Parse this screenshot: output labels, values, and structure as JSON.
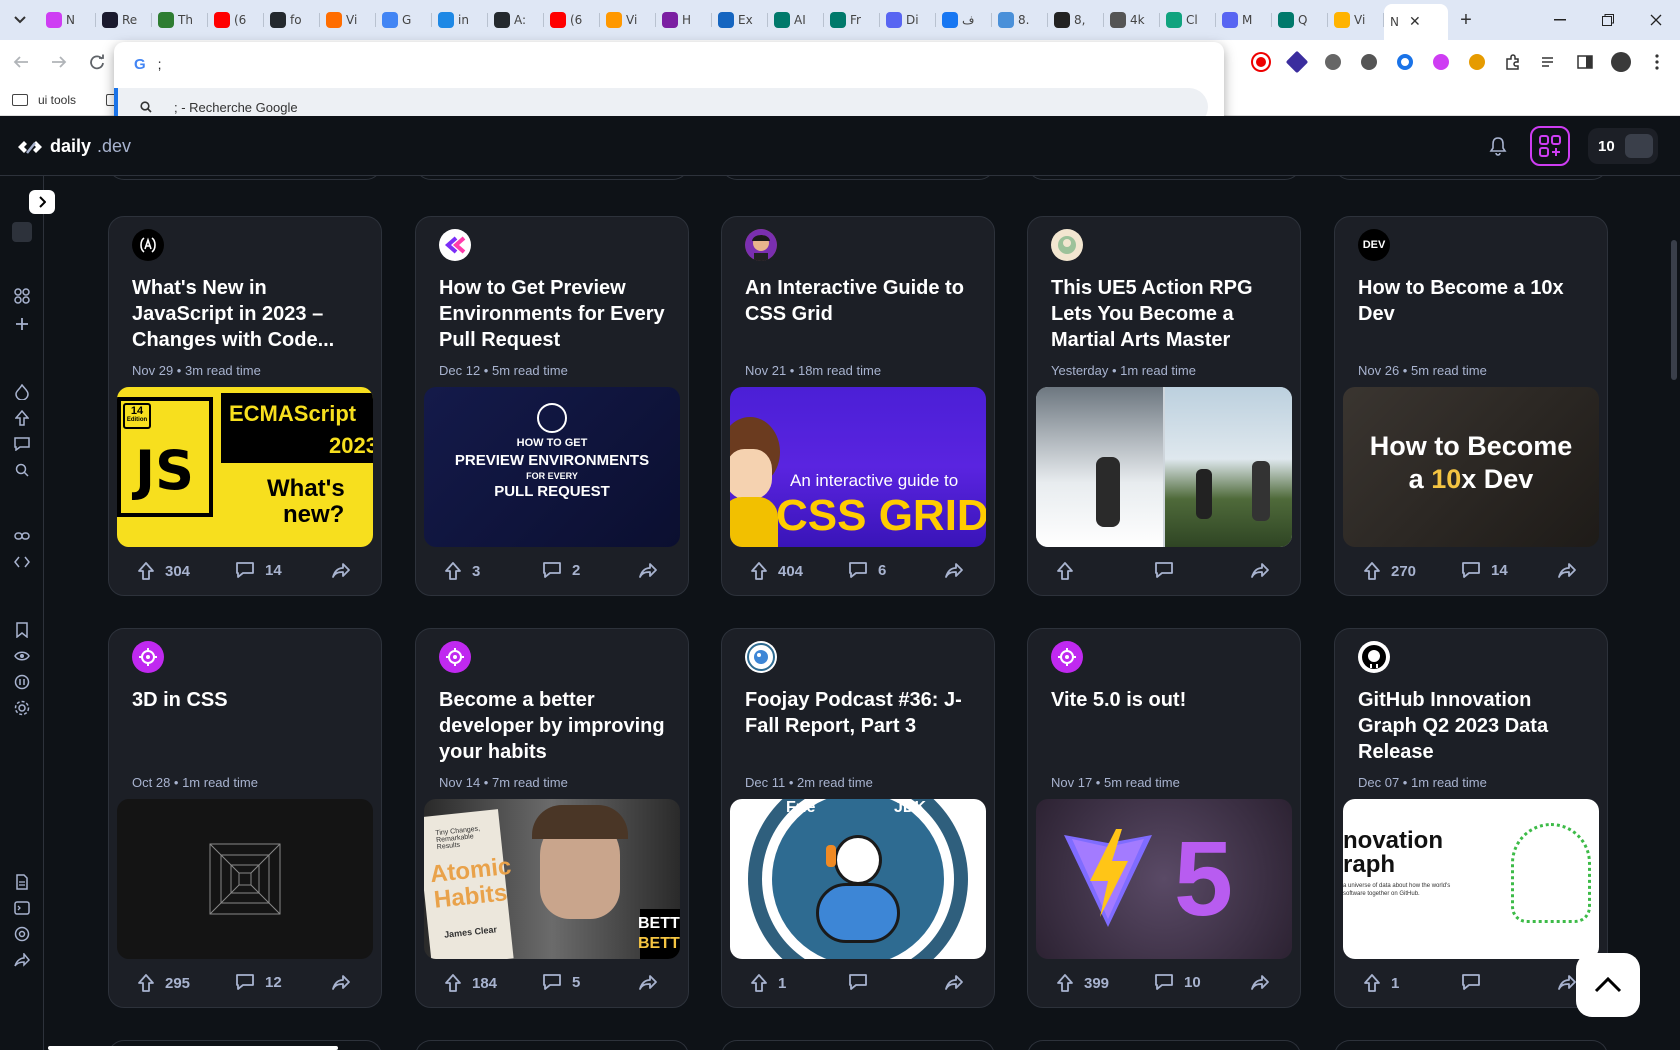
{
  "browser": {
    "tabs": [
      {
        "title": "N",
        "color": "#ce3df3"
      },
      {
        "title": "Re",
        "color": "#1a1a2e"
      },
      {
        "title": "Th",
        "color": "#2e7d32"
      },
      {
        "title": "(6",
        "color": "#ff0000"
      },
      {
        "title": "fo",
        "color": "#24292e"
      },
      {
        "title": "Vi",
        "color": "#ff6d00"
      },
      {
        "title": "G",
        "color": "#4285f4"
      },
      {
        "title": "in",
        "color": "#1e88e5"
      },
      {
        "title": "A:",
        "color": "#24292e"
      },
      {
        "title": "(6",
        "color": "#ff0000"
      },
      {
        "title": "Vi",
        "color": "#ff9800"
      },
      {
        "title": "H",
        "color": "#7b1fa2"
      },
      {
        "title": "Ex",
        "color": "#1565c0"
      },
      {
        "title": "AI",
        "color": "#00796b"
      },
      {
        "title": "Fr",
        "color": "#00796b"
      },
      {
        "title": "Di",
        "color": "#5865f2"
      },
      {
        "title": "ف",
        "color": "#1877f2"
      },
      {
        "title": "8.",
        "color": "#4a90d9"
      },
      {
        "title": "8,",
        "color": "#222222"
      },
      {
        "title": "4k",
        "color": "#555555"
      },
      {
        "title": "Cl",
        "color": "#10a37f"
      },
      {
        "title": "M",
        "color": "#5865f2"
      },
      {
        "title": "Q",
        "color": "#00796b"
      },
      {
        "title": "Vi",
        "color": "#ffb300"
      }
    ],
    "active_tab": {
      "title": "N",
      "close": "✕"
    },
    "new_tab": "+",
    "omnibox": {
      "typed": ";",
      "suggestion": "; - Recherche Google",
      "engine_letter": "G"
    },
    "bookmarks": [
      {
        "label": "ui tools"
      }
    ]
  },
  "app": {
    "logo_main": "daily",
    "logo_suffix": ".dev",
    "reputation": "10",
    "accent": "#ce3df3"
  },
  "cards": [
    {
      "source": "(A)",
      "source_bg": "#000000",
      "title": "What's New in JavaScript in 2023 – Changes with Code...",
      "meta": "Nov 29 • 3m read time",
      "upvotes": "304",
      "comments": "14",
      "img": {
        "kind": "js",
        "line1": "ECMAScript",
        "line2": "2023",
        "line3": "What's",
        "line4": "new?",
        "badge": "JS",
        "edition": "14",
        "edition_label": "Edition"
      }
    },
    {
      "source": "K",
      "source_bg": "#ffffff",
      "title": "How to Get Preview Environments for Every Pull Request",
      "meta": "Dec 12 • 5m read time",
      "upvotes": "3",
      "comments": "2",
      "img": {
        "kind": "preview",
        "line1": "HOW TO GET",
        "line2": "PREVIEW ENVIRONMENTS",
        "line3": "FOR EVERY",
        "line4": "PULL REQUEST"
      }
    },
    {
      "source": "",
      "source_bg": "#7b4a2a",
      "title": "An Interactive Guide to CSS Grid",
      "meta": "Nov 21 • 18m read time",
      "upvotes": "404",
      "comments": "6",
      "img": {
        "kind": "grid",
        "line1": "An interactive guide to",
        "line2": "CSS GRID"
      }
    },
    {
      "source": "",
      "source_bg": "#f2e6d0",
      "title": "This UE5 Action RPG Lets You Become a Martial Arts Master",
      "meta": "Yesterday • 1m read time",
      "upvotes": "",
      "comments": "",
      "img": {
        "kind": "ue5"
      }
    },
    {
      "source": "DEV",
      "source_bg": "#000000",
      "title": "How to Become a 10x Dev",
      "meta": "Nov 26 • 5m read time",
      "upvotes": "270",
      "comments": "14",
      "img": {
        "kind": "tenx",
        "line1": "How to Become",
        "line2a": "a ",
        "line2b": "10",
        "line2c": "x Dev"
      }
    },
    {
      "source": "",
      "source_bg": "#c029f0",
      "title": "3D in CSS",
      "meta": "Oct 28 • 1m read time",
      "upvotes": "295",
      "comments": "12",
      "img": {
        "kind": "tunnel"
      }
    },
    {
      "source": "",
      "source_bg": "#c029f0",
      "title": "Become a better developer by improving your habits",
      "meta": "Nov 14 • 7m read time",
      "upvotes": "184",
      "comments": "5",
      "img": {
        "kind": "habits",
        "line1": "Atomic",
        "line2": "Habits",
        "line3": "James Clear",
        "line4": "BETTI",
        "line5": "BETT",
        "line6": "Tiny Changes, Remarkable Results"
      }
    },
    {
      "source": "",
      "source_bg": "#ffffff",
      "title": "Foojay Podcast #36: J-Fall Report, Part 3",
      "meta": "Dec 11 • 2m read time",
      "upvotes": "1",
      "comments": "",
      "img": {
        "kind": "foojay",
        "line1": "Frie",
        "line2": "JDK"
      }
    },
    {
      "source": "",
      "source_bg": "#c029f0",
      "title": "Vite 5.0 is out!",
      "meta": "Nov 17 • 5m read time",
      "upvotes": "399",
      "comments": "10",
      "img": {
        "kind": "vite",
        "line1": "5"
      }
    },
    {
      "source": "",
      "source_bg": "#ffffff",
      "title": "GitHub Innovation Graph Q2 2023 Data Release",
      "meta": "Dec 07 • 1m read time",
      "upvotes": "1",
      "comments": "",
      "img": {
        "kind": "ghgraph",
        "line1": "novation",
        "line2": "raph",
        "line3": "a universe of data about how the world's",
        "line4": "software together on GitHub."
      }
    }
  ]
}
